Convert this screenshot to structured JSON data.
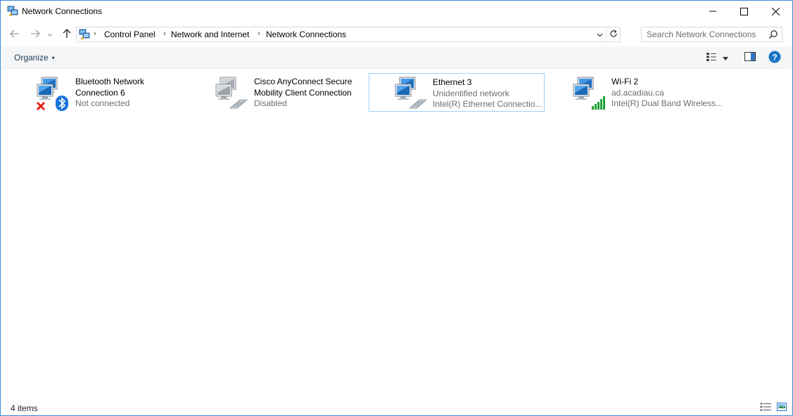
{
  "window": {
    "title": "Network Connections",
    "minimize_icon": "minimize-icon",
    "maximize_icon": "maximize-icon",
    "close_icon": "close-icon"
  },
  "nav": {
    "back_icon": "back-arrow-icon",
    "forward_icon": "forward-arrow-icon",
    "recent_icon": "chevron-down-icon",
    "up_icon": "up-arrow-icon"
  },
  "address": {
    "breadcrumbs": [
      "Control Panel",
      "Network and Internet",
      "Network Connections"
    ],
    "separator": "›",
    "location_icon": "network-connections-icon"
  },
  "search": {
    "placeholder": "Search Network Connections",
    "value": ""
  },
  "toolbar": {
    "organize_label": "Organize",
    "organize_caret": "▾",
    "view_options_icon": "change-view-icon",
    "preview_pane_icon": "preview-pane-icon",
    "help_icon": "help-icon",
    "help_label": "?"
  },
  "connections": [
    {
      "name_line1": "Bluetooth Network",
      "name_line2": "Connection 6",
      "status": "Not connected",
      "device": "",
      "icon": "bluetooth-network-icon",
      "badge": "red-x-disconnected"
    },
    {
      "name_line1": "Cisco AnyConnect Secure",
      "name_line2": "Mobility Client Connection",
      "status": "Disabled",
      "device": "",
      "icon": "ethernet-disabled-icon"
    },
    {
      "name_line1": "Ethernet 3",
      "name_line2": "",
      "status": "Unidentified network",
      "device": "Intel(R) Ethernet Connectio...",
      "icon": "ethernet-icon",
      "selected": true
    },
    {
      "name_line1": "Wi-Fi 2",
      "name_line2": "",
      "status": "ad.acadiau.ca",
      "device": "Intel(R) Dual Band Wireless...",
      "icon": "wifi-signal-icon"
    }
  ],
  "statusbar": {
    "item_count": "4 items",
    "details_view_icon": "details-view-icon",
    "large_icons_view_icon": "large-icons-view-icon"
  },
  "colors": {
    "accent": "#3d8bd6",
    "selection_border": "#99d1ff",
    "secondary_text": "#6d6d6d",
    "help_blue": "#1a73c8"
  }
}
